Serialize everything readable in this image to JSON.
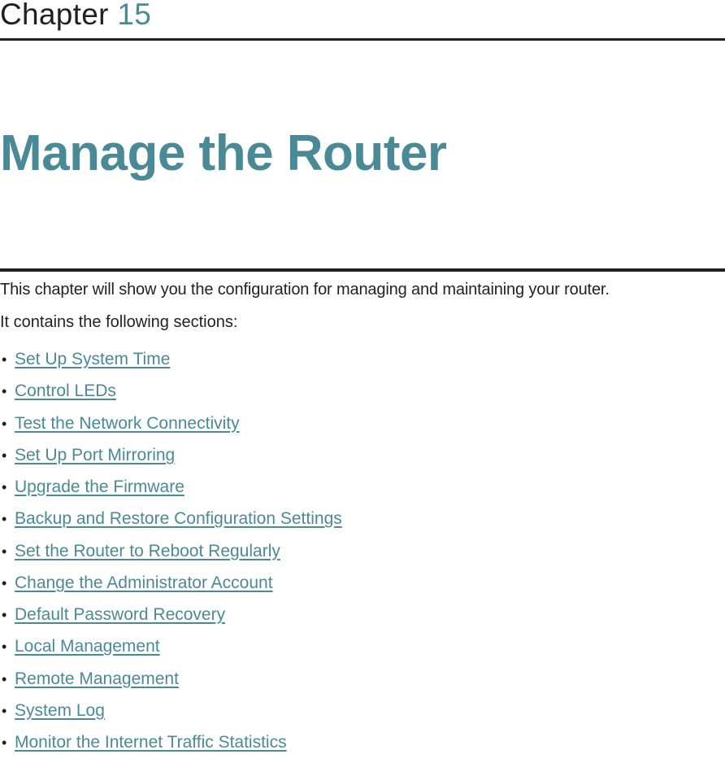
{
  "chapter": {
    "label": "Chapter",
    "number": "15"
  },
  "title": "Manage the Router",
  "intro": "This chapter will show you the configuration for managing and maintaining your router.",
  "sections_intro": "It contains the following sections:",
  "colors": {
    "accent": "#4a8a96",
    "text": "#231f20",
    "rule": "#231f20"
  },
  "bullet_glyph": "•",
  "sections": [
    {
      "label": "Set Up System Time"
    },
    {
      "label": "Control LEDs"
    },
    {
      "label": "Test the Network Connectivity"
    },
    {
      "label": "Set Up Port Mirroring"
    },
    {
      "label": "Upgrade the Firmware"
    },
    {
      "label": "Backup and Restore Configuration Settings"
    },
    {
      "label": "Set the Router to Reboot Regularly"
    },
    {
      "label": "Change the Administrator Account"
    },
    {
      "label": "Default Password Recovery"
    },
    {
      "label": "Local Management"
    },
    {
      "label": "Remote Management"
    },
    {
      "label": "System Log"
    },
    {
      "label": "Monitor the Internet Traffic Statistics"
    }
  ]
}
